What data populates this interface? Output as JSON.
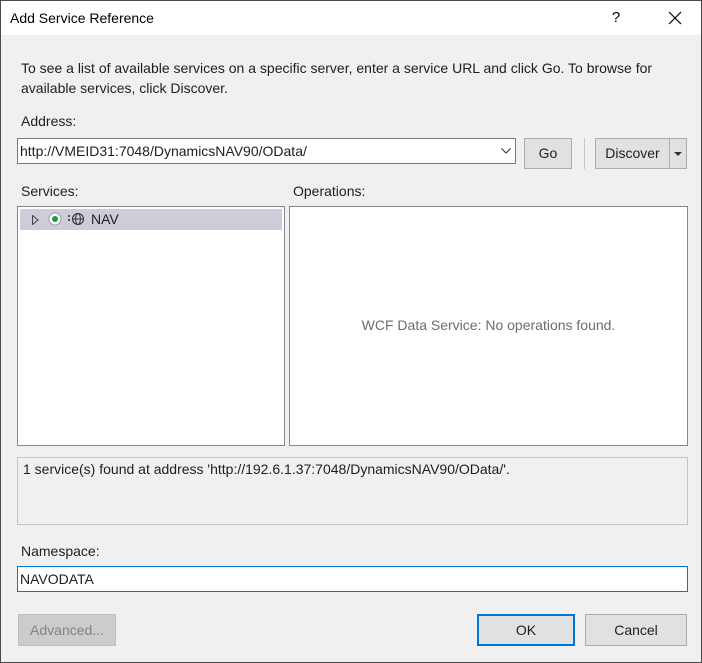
{
  "window": {
    "title": "Add Service Reference",
    "help_glyph": "?",
    "close_icon": "close-icon"
  },
  "description": "To see a list of available services on a specific server, enter a service URL and click Go. To browse for available services, click Discover.",
  "address": {
    "label": "Address:",
    "value": "http://VMEID31:7048/DynamicsNAV90/OData/",
    "go_label": "Go",
    "discover_label": "Discover"
  },
  "services": {
    "label": "Services:",
    "items": [
      {
        "label": "NAV",
        "expanded": false,
        "selected": true
      }
    ]
  },
  "operations": {
    "label": "Operations:",
    "empty_message": "WCF Data Service: No operations found."
  },
  "status": {
    "message": "1 service(s) found at address 'http://192.6.1.37:7048/DynamicsNAV90/OData/'."
  },
  "namespace": {
    "label": "Namespace:",
    "value": "NAVODATA"
  },
  "buttons": {
    "advanced_label": "Advanced...",
    "ok_label": "OK",
    "cancel_label": "Cancel"
  },
  "colors": {
    "accent": "#0078d7",
    "selection": "#cdcdd9",
    "disabled_text": "#838383",
    "running_status": "#1a9e3a"
  }
}
